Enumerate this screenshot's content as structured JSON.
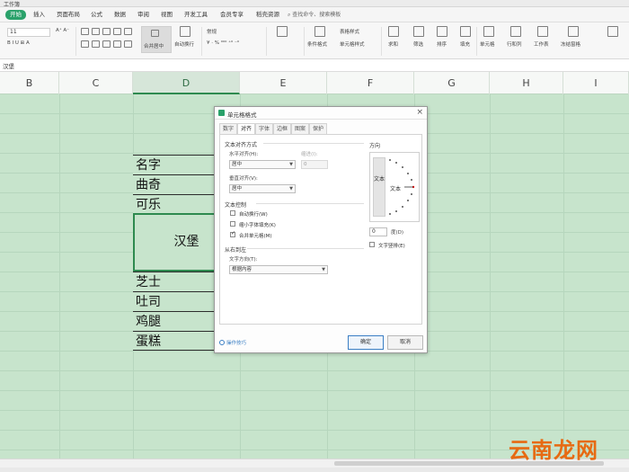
{
  "titlebar": {
    "doc_name": "工作簿"
  },
  "menu": {
    "items": [
      "开始",
      "插入",
      "页面布局",
      "公式",
      "数据",
      "审阅",
      "视图",
      "开发工具",
      "会员专享",
      "稻壳资源"
    ],
    "active_index": 0,
    "search": "查找命令、搜索模板"
  },
  "toolbar": {
    "font_size": "11",
    "merge_label": "合并居中",
    "wrap_label": "自动换行",
    "number_format": "常规",
    "cond_format": "条件格式",
    "table_style": "表格样式",
    "cell_style": "单元格样式",
    "sum_label": "求和",
    "filter_label": "筛选",
    "sort_label": "排序",
    "fill_label": "填充",
    "cell_label": "单元格",
    "rowcol_label": "行和列",
    "worksheet_label": "工作表",
    "freeze_label": "冻结窗格"
  },
  "formula_bar": {
    "cell_ref": "汉堡"
  },
  "columns": [
    "B",
    "C",
    "D",
    "E",
    "F",
    "G",
    "H",
    "I"
  ],
  "selected_column": "D",
  "cells": {
    "r1": "名字",
    "r2": "曲奇",
    "r3": "可乐",
    "merged": "汉堡",
    "r5": "芝士",
    "r6": "吐司",
    "r7": "鸡腿",
    "r8": "蛋糕"
  },
  "watermark": "云南龙网",
  "dialog": {
    "title": "单元格格式",
    "close": "×",
    "tabs": [
      "数字",
      "对齐",
      "字体",
      "边框",
      "图案",
      "保护"
    ],
    "active_tab": 1,
    "text_align_section": "文本对齐方式",
    "horizontal_label": "水平对齐(H):",
    "horizontal_value": "居中",
    "indent_label": "缩进(I):",
    "indent_value": "0",
    "vertical_label": "垂直对齐(V):",
    "vertical_value": "居中",
    "text_control_section": "文本控制",
    "wrap_text": "自动换行(W)",
    "shrink_fit": "缩小字体填充(K)",
    "merge_cells": "合并单元格(M)",
    "rtl_section": "从右到左",
    "direction_label": "文字方向(T):",
    "direction_value": "根据内容",
    "orientation_label": "方向",
    "vertical_text": "文本",
    "horizontal_text": "文本",
    "degree_value": "0",
    "degree_label": "度(D)",
    "vertical_text_check": "文字竖排(E)",
    "tips": "操作技巧",
    "ok": "确定",
    "cancel": "取消"
  }
}
